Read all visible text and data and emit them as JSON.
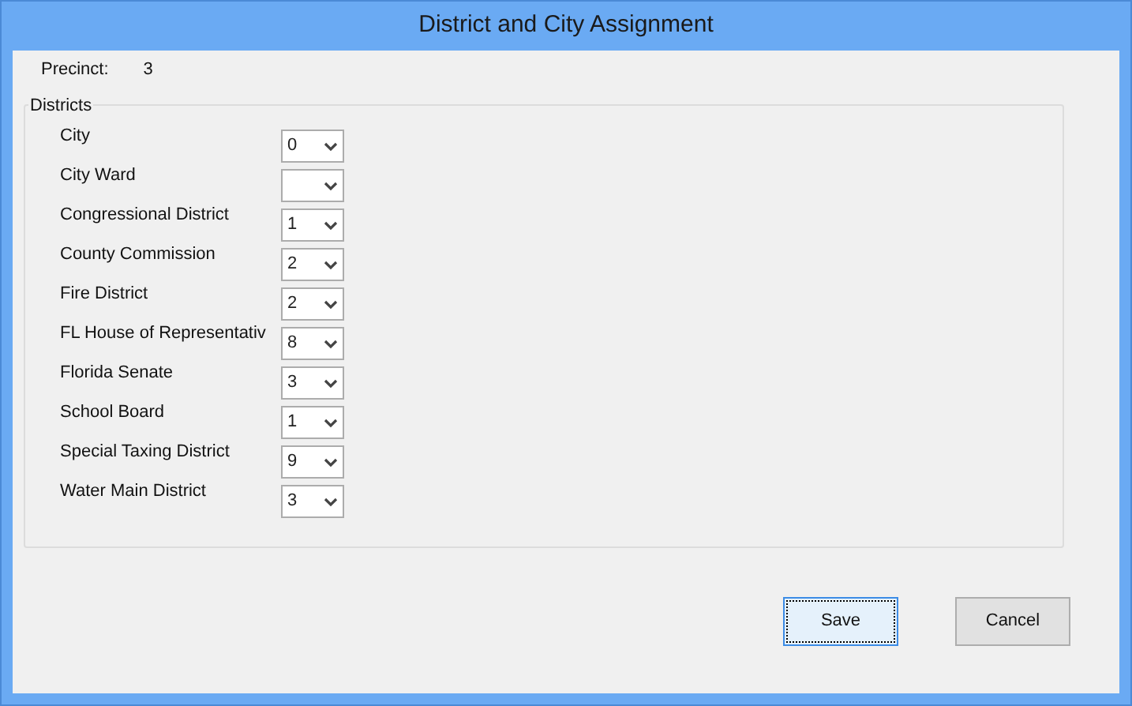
{
  "window": {
    "title": "District and City Assignment"
  },
  "precinct": {
    "label": "Precinct:",
    "value": "3"
  },
  "districts": {
    "title": "Districts",
    "fields": [
      {
        "label": "City",
        "value": "0"
      },
      {
        "label": "City Ward"
      },
      {
        "label": "Congressional District",
        "value": "1"
      },
      {
        "label": "County Commission",
        "value": "2"
      },
      {
        "label": "Fire District",
        "value": "2"
      },
      {
        "label": "FL House of Representativ",
        "value": "8"
      },
      {
        "label": "Florida Senate",
        "value": "3"
      },
      {
        "label": "School Board",
        "value": "1"
      },
      {
        "label": "Special Taxing District",
        "value": "9"
      },
      {
        "label": "Water Main District",
        "value": "3"
      }
    ]
  },
  "buttons": [
    {
      "label": "Save",
      "focused": true
    },
    {
      "label": "Cancel",
      "focused": false
    }
  ]
}
